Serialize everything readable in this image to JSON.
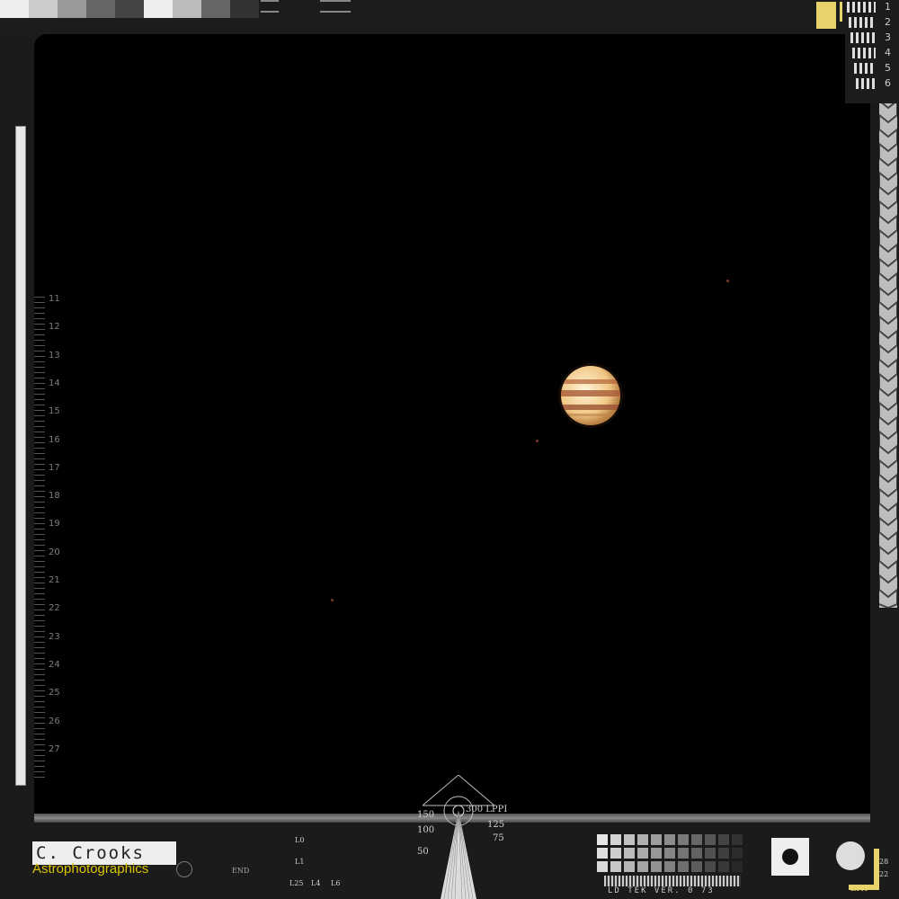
{
  "scale_labels": [
    "11",
    "12",
    "13",
    "14",
    "15",
    "16",
    "17",
    "18",
    "19",
    "20",
    "21",
    "22",
    "23",
    "24",
    "25",
    "26",
    "27"
  ],
  "resolution_numbers": [
    "1",
    "2",
    "3",
    "4",
    "5",
    "6"
  ],
  "lppi": {
    "label": "300 LPPI",
    "values": [
      "150",
      "125",
      "100",
      "75",
      "50"
    ]
  },
  "target_labels": [
    "L0",
    "L1",
    "L25",
    "L4",
    "L6"
  ],
  "end_label": "END",
  "bottom_code": "LD TEK VER. 0 73",
  "corner_label": "LTH",
  "small_numbers": [
    "28",
    "22"
  ],
  "watermark": {
    "line1": "C. Crooks",
    "line2": "Astrophotographics"
  },
  "colors": {
    "accent_yellow": "#e8d36a",
    "frame_dark": "#1a1a1a",
    "sky": "#000000",
    "watermark_yellow": "#d9c400"
  }
}
